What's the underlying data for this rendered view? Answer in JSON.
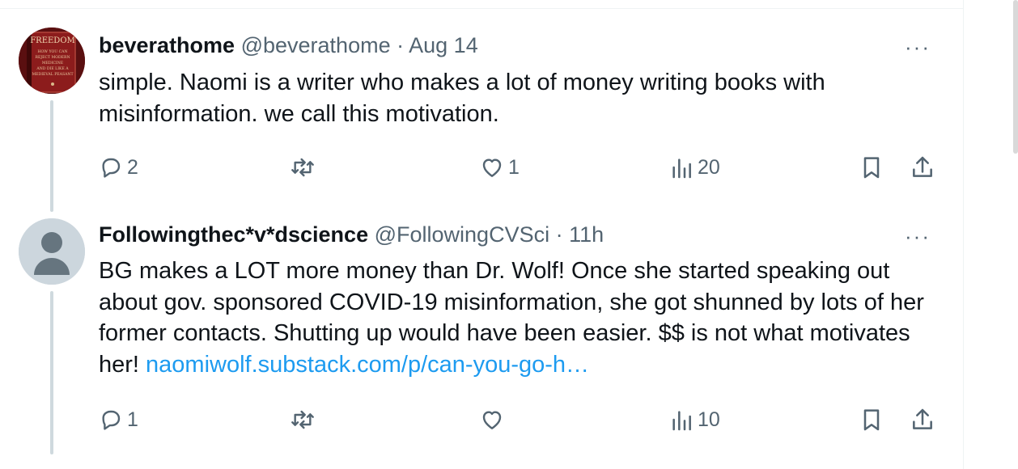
{
  "tweets": [
    {
      "name": "beverathome",
      "handle": "@beverathome",
      "separator": "·",
      "time": "Aug 14",
      "more": "···",
      "text": "simple. Naomi is a writer who makes a lot of money writing books with misinformation. we call this motivation.",
      "link": "",
      "avatar_text": [
        "FREEDOM",
        "HOW YOU CAN",
        "REJECT MODERN",
        "MEDICINE",
        "AND DIE LIKE A",
        "MEDIEVAL PEASANT"
      ],
      "actions": {
        "replies": "2",
        "retweets": "",
        "likes": "1",
        "views": "20"
      }
    },
    {
      "name": "Followingthec*v*dscience",
      "handle": "@FollowingCVSci",
      "separator": "·",
      "time": "11h",
      "more": "···",
      "text": "BG makes a LOT more money than Dr. Wolf! Once she started speaking out about gov. sponsored COVID-19 misinformation, she got shunned by lots of her former  contacts. Shutting up would have been easier. $$ is not what motivates her! ",
      "link": "naomiwolf.substack.com/p/can-you-go-h…",
      "actions": {
        "replies": "1",
        "retweets": "",
        "likes": "",
        "views": "10"
      }
    }
  ],
  "icons": [
    "reply-icon",
    "retweet-icon",
    "like-icon",
    "views-icon",
    "bookmark-icon",
    "share-icon",
    "more-icon"
  ],
  "colors": {
    "text": "#0f1419",
    "secondary": "#536471",
    "link": "#1d9bf0",
    "thread_line": "#cfd9de",
    "avatar_bg": "#ccd6dd"
  }
}
